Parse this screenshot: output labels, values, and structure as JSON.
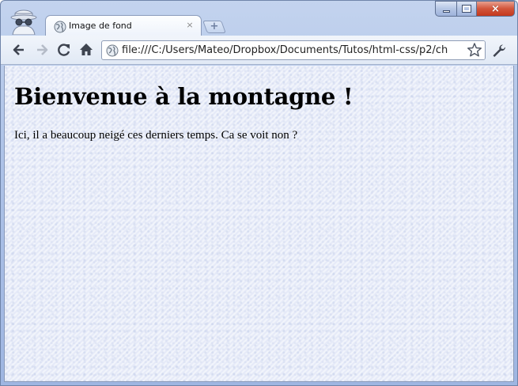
{
  "browser": {
    "tab": {
      "title": "Image de fond",
      "close_glyph": "×",
      "favicon": "globe-icon"
    },
    "new_tab_glyph": "+",
    "window_controls": {
      "minimize": "minimize-icon",
      "maximize": "maximize-icon",
      "close": "×"
    },
    "toolbar": {
      "back": "back-arrow-icon",
      "forward": "forward-arrow-icon",
      "reload": "reload-icon",
      "home": "home-icon",
      "address": "file:///C:/Users/Mateo/Dropbox/Documents/Tutos/html-css/p2/ch",
      "bookmark": "star-icon",
      "menu": "wrench-icon"
    },
    "mode": "incognito-icon"
  },
  "page": {
    "heading": "Bienvenue à la montagne !",
    "paragraph": "Ici, il a beaucoup neigé ces derniers temps. Ca se voit non ?"
  },
  "colors": {
    "frame": "#aec3e8",
    "close_button": "#c4381d",
    "page_background": "#f1f4fb"
  }
}
